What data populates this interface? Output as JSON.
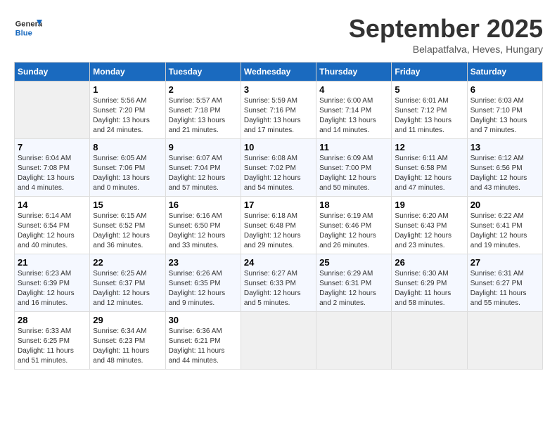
{
  "header": {
    "logo_text_general": "General",
    "logo_text_blue": "Blue",
    "month_title": "September 2025",
    "subtitle": "Belapatfalva, Heves, Hungary"
  },
  "calendar": {
    "weekdays": [
      "Sunday",
      "Monday",
      "Tuesday",
      "Wednesday",
      "Thursday",
      "Friday",
      "Saturday"
    ],
    "weeks": [
      [
        {
          "day": "",
          "empty": true
        },
        {
          "day": "1",
          "sunrise": "5:56 AM",
          "sunset": "7:20 PM",
          "daylight": "13 hours and 24 minutes."
        },
        {
          "day": "2",
          "sunrise": "5:57 AM",
          "sunset": "7:18 PM",
          "daylight": "13 hours and 21 minutes."
        },
        {
          "day": "3",
          "sunrise": "5:59 AM",
          "sunset": "7:16 PM",
          "daylight": "13 hours and 17 minutes."
        },
        {
          "day": "4",
          "sunrise": "6:00 AM",
          "sunset": "7:14 PM",
          "daylight": "13 hours and 14 minutes."
        },
        {
          "day": "5",
          "sunrise": "6:01 AM",
          "sunset": "7:12 PM",
          "daylight": "13 hours and 11 minutes."
        },
        {
          "day": "6",
          "sunrise": "6:03 AM",
          "sunset": "7:10 PM",
          "daylight": "13 hours and 7 minutes."
        }
      ],
      [
        {
          "day": "7",
          "sunrise": "6:04 AM",
          "sunset": "7:08 PM",
          "daylight": "13 hours and 4 minutes."
        },
        {
          "day": "8",
          "sunrise": "6:05 AM",
          "sunset": "7:06 PM",
          "daylight": "13 hours and 0 minutes."
        },
        {
          "day": "9",
          "sunrise": "6:07 AM",
          "sunset": "7:04 PM",
          "daylight": "12 hours and 57 minutes."
        },
        {
          "day": "10",
          "sunrise": "6:08 AM",
          "sunset": "7:02 PM",
          "daylight": "12 hours and 54 minutes."
        },
        {
          "day": "11",
          "sunrise": "6:09 AM",
          "sunset": "7:00 PM",
          "daylight": "12 hours and 50 minutes."
        },
        {
          "day": "12",
          "sunrise": "6:11 AM",
          "sunset": "6:58 PM",
          "daylight": "12 hours and 47 minutes."
        },
        {
          "day": "13",
          "sunrise": "6:12 AM",
          "sunset": "6:56 PM",
          "daylight": "12 hours and 43 minutes."
        }
      ],
      [
        {
          "day": "14",
          "sunrise": "6:14 AM",
          "sunset": "6:54 PM",
          "daylight": "12 hours and 40 minutes."
        },
        {
          "day": "15",
          "sunrise": "6:15 AM",
          "sunset": "6:52 PM",
          "daylight": "12 hours and 36 minutes."
        },
        {
          "day": "16",
          "sunrise": "6:16 AM",
          "sunset": "6:50 PM",
          "daylight": "12 hours and 33 minutes."
        },
        {
          "day": "17",
          "sunrise": "6:18 AM",
          "sunset": "6:48 PM",
          "daylight": "12 hours and 29 minutes."
        },
        {
          "day": "18",
          "sunrise": "6:19 AM",
          "sunset": "6:46 PM",
          "daylight": "12 hours and 26 minutes."
        },
        {
          "day": "19",
          "sunrise": "6:20 AM",
          "sunset": "6:43 PM",
          "daylight": "12 hours and 23 minutes."
        },
        {
          "day": "20",
          "sunrise": "6:22 AM",
          "sunset": "6:41 PM",
          "daylight": "12 hours and 19 minutes."
        }
      ],
      [
        {
          "day": "21",
          "sunrise": "6:23 AM",
          "sunset": "6:39 PM",
          "daylight": "12 hours and 16 minutes."
        },
        {
          "day": "22",
          "sunrise": "6:25 AM",
          "sunset": "6:37 PM",
          "daylight": "12 hours and 12 minutes."
        },
        {
          "day": "23",
          "sunrise": "6:26 AM",
          "sunset": "6:35 PM",
          "daylight": "12 hours and 9 minutes."
        },
        {
          "day": "24",
          "sunrise": "6:27 AM",
          "sunset": "6:33 PM",
          "daylight": "12 hours and 5 minutes."
        },
        {
          "day": "25",
          "sunrise": "6:29 AM",
          "sunset": "6:31 PM",
          "daylight": "12 hours and 2 minutes."
        },
        {
          "day": "26",
          "sunrise": "6:30 AM",
          "sunset": "6:29 PM",
          "daylight": "11 hours and 58 minutes."
        },
        {
          "day": "27",
          "sunrise": "6:31 AM",
          "sunset": "6:27 PM",
          "daylight": "11 hours and 55 minutes."
        }
      ],
      [
        {
          "day": "28",
          "sunrise": "6:33 AM",
          "sunset": "6:25 PM",
          "daylight": "11 hours and 51 minutes."
        },
        {
          "day": "29",
          "sunrise": "6:34 AM",
          "sunset": "6:23 PM",
          "daylight": "11 hours and 48 minutes."
        },
        {
          "day": "30",
          "sunrise": "6:36 AM",
          "sunset": "6:21 PM",
          "daylight": "11 hours and 44 minutes."
        },
        {
          "day": "",
          "empty": true
        },
        {
          "day": "",
          "empty": true
        },
        {
          "day": "",
          "empty": true
        },
        {
          "day": "",
          "empty": true
        }
      ]
    ]
  }
}
